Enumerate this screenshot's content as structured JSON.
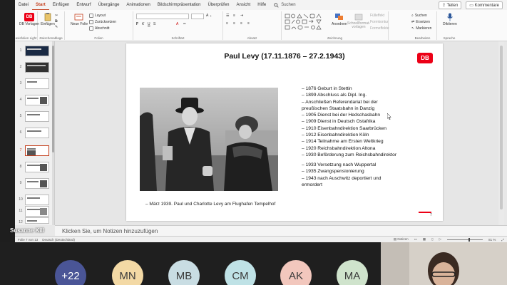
{
  "ribbon": {
    "tabs": [
      "Datei",
      "Start",
      "Einfügen",
      "Entwurf",
      "Übergänge",
      "Animationen",
      "Bildschirmpräsentation",
      "Überprüfen",
      "Ansicht",
      "Hilfe"
    ],
    "search_label": "Suchen",
    "share_label": "Teilen",
    "comments_label": "Kommentare",
    "groups": {
      "vorlagen": {
        "btn": "DB Vorlagen",
        "label": "axisfolien Light"
      },
      "zwischenablage": {
        "btn": "Einfügen",
        "label": "Zwischenablage"
      },
      "folien": {
        "neue": "Neue Folie",
        "layout": "Layout",
        "zuruecksetzen": "Zurücksetzen",
        "abschnitt": "Abschnitt",
        "label": "Folien"
      },
      "schriftart": {
        "label": "Schriftart"
      },
      "absatz": {
        "label": "Absatz"
      },
      "zeichnung": {
        "anordnen": "Anordnen",
        "schnellformat": "Schnellformat-vorlagen",
        "fuelleffekt": "Fülleffekt",
        "formkontur": "Formkontur",
        "formeffekte": "Formeffekte",
        "label": "Zeichnung"
      },
      "bearbeiten": {
        "suchen": "Suchen",
        "ersetzen": "Ersetzen",
        "markieren": "Markieren",
        "label": "Bearbeiten"
      },
      "sprache": {
        "diktieren": "Diktieren",
        "label": "Sprache"
      }
    }
  },
  "thumbnails": [
    {
      "num": "1"
    },
    {
      "num": "2"
    },
    {
      "num": "3"
    },
    {
      "num": "4"
    },
    {
      "num": "5"
    },
    {
      "num": "6"
    },
    {
      "num": "7"
    },
    {
      "num": "8"
    },
    {
      "num": "9"
    },
    {
      "num": "10"
    },
    {
      "num": "11"
    },
    {
      "num": "12"
    }
  ],
  "slide": {
    "title": "Paul Levy (17.11.1876 – 27.2.1943)",
    "logo_text": "DB",
    "bio": [
      "– 1876 Geburt in Stettin",
      "– 1899 Abschluss als Dipl. Ing.",
      "– Anschließen Referendariat bei der",
      "   preußischen Staatsbahn in Danzig",
      "– 1905 Dienst bei der Hedschasbahn",
      "– 1909 Dienst in Deutsch Ostafrika",
      "– 1910 Eisenbahndirektion Saarbrücken",
      "– 1912 Eisenbahndirektion Köln",
      "– 1914 Teilnahme am Ersten Weltkrieg",
      "– 1920 Reichsbahndirektion Altona",
      "– 1930 Beförderung zum Reichsbahndirektor"
    ],
    "bio2": [
      "– 1933 Versetzung nach Wuppertal",
      "– 1935 Zwangspensionierung",
      "– 1943 nach Auschwitz deportiert und",
      "   ermordert"
    ],
    "caption": "– März 1939. Paul und Charlotte Levy am Flughafen Tempelhof",
    "page_number": "7"
  },
  "notes_placeholder": "Klicken Sie, um Notizen hinzuzufügen",
  "status": {
    "slide_info": "Folie 7 von 13",
    "language": "Deutsch (Deutschland)",
    "notes": "Notizen",
    "zoom": "81 %"
  },
  "meeting": {
    "presenter_name": "Susanne Kill",
    "participants": [
      {
        "label": "+22",
        "color": "#4a5596",
        "text": "#ffffff"
      },
      {
        "label": "MN",
        "color": "#f3d9a5",
        "text": "#3b3b3b"
      },
      {
        "label": "MB",
        "color": "#c9dde3",
        "text": "#3b3b3b"
      },
      {
        "label": "CM",
        "color": "#bfe2e6",
        "text": "#3b3b3b"
      },
      {
        "label": "AK",
        "color": "#f2c7bd",
        "text": "#3b3b3b"
      },
      {
        "label": "MA",
        "color": "#cfe3cc",
        "text": "#3b3b3b"
      }
    ]
  },
  "colors": {
    "accent": "#c43e1c",
    "db_red": "#ec0016"
  }
}
